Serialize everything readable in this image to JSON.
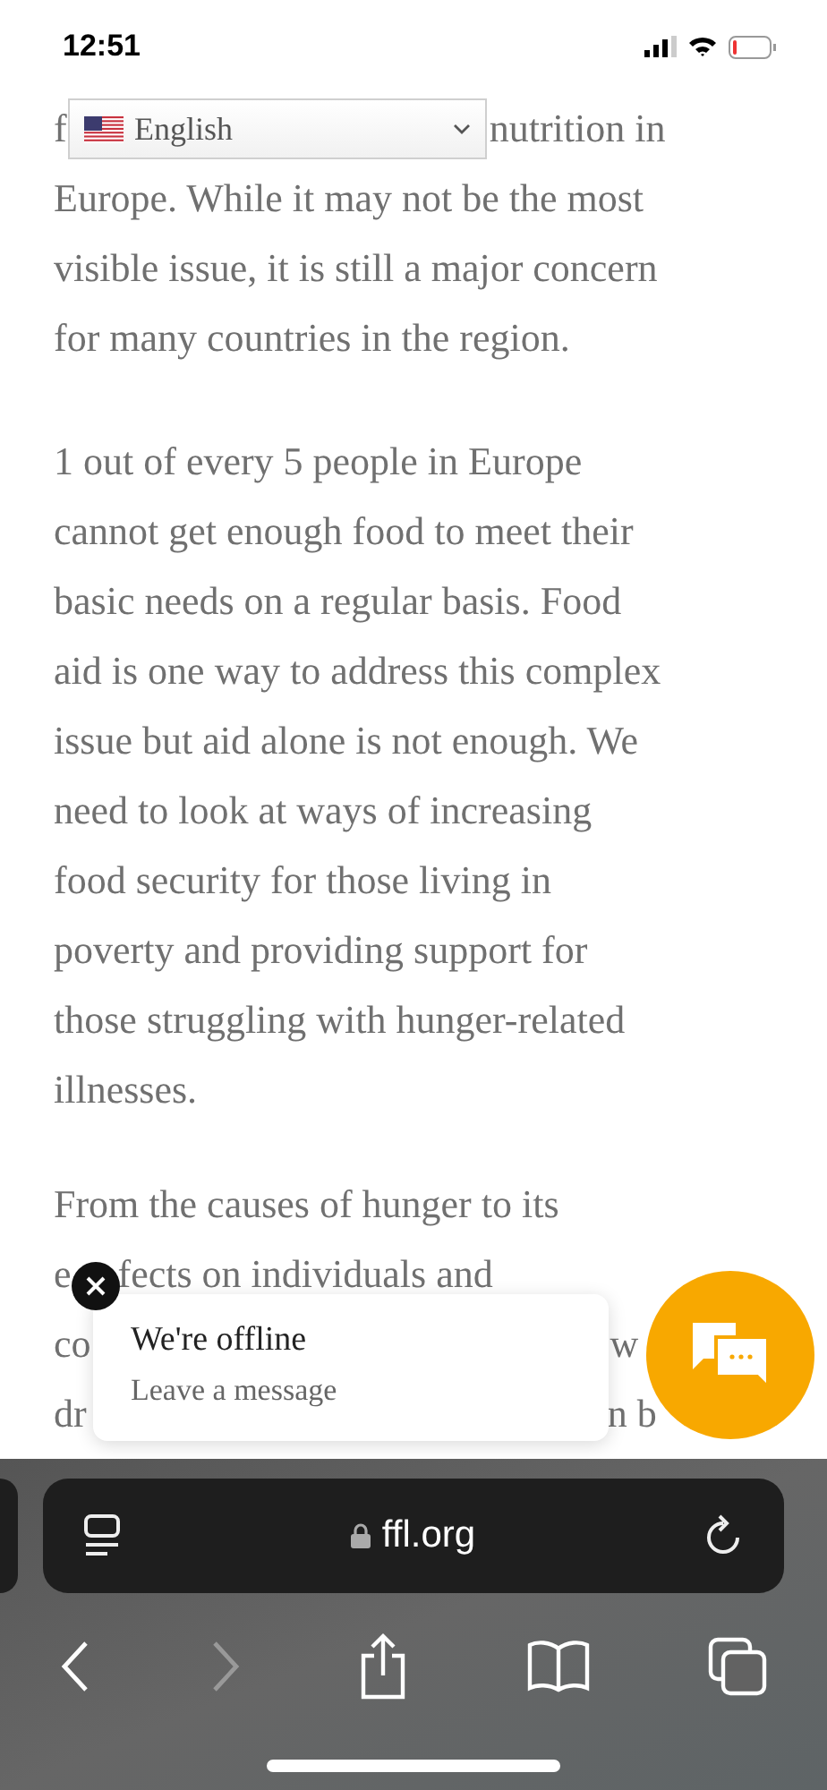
{
  "status_bar": {
    "time": "12:51"
  },
  "language_select": {
    "value": "English"
  },
  "article": {
    "first_line": {
      "start": "f",
      "end": "nutrition in"
    },
    "paragraphs": [
      [
        "Europe. While it may not be the most",
        "visible issue, it is still a major concern",
        "for many countries in the region."
      ],
      [
        "1 out of every 5 people in Europe",
        "cannot get enough food to meet their",
        "basic needs on a regular basis. Food",
        "aid is one way to address this complex",
        "issue but aid alone is not enough. We",
        "need to look at ways of increasing",
        "food security for those living in",
        "poverty and providing support for",
        "those struggling with hunger-related",
        "illnesses."
      ],
      [
        "From the causes of hunger to its"
      ]
    ],
    "covered_lines": [
      {
        "start": "e",
        "end": "fects on individuals and"
      },
      {
        "start": "co",
        "end": "w"
      },
      {
        "start": "dr",
        "end": "n b"
      }
    ]
  },
  "chat_popup": {
    "title": "We're offline",
    "subtitle": "Leave a message"
  },
  "browser": {
    "url": "ffl.org"
  }
}
